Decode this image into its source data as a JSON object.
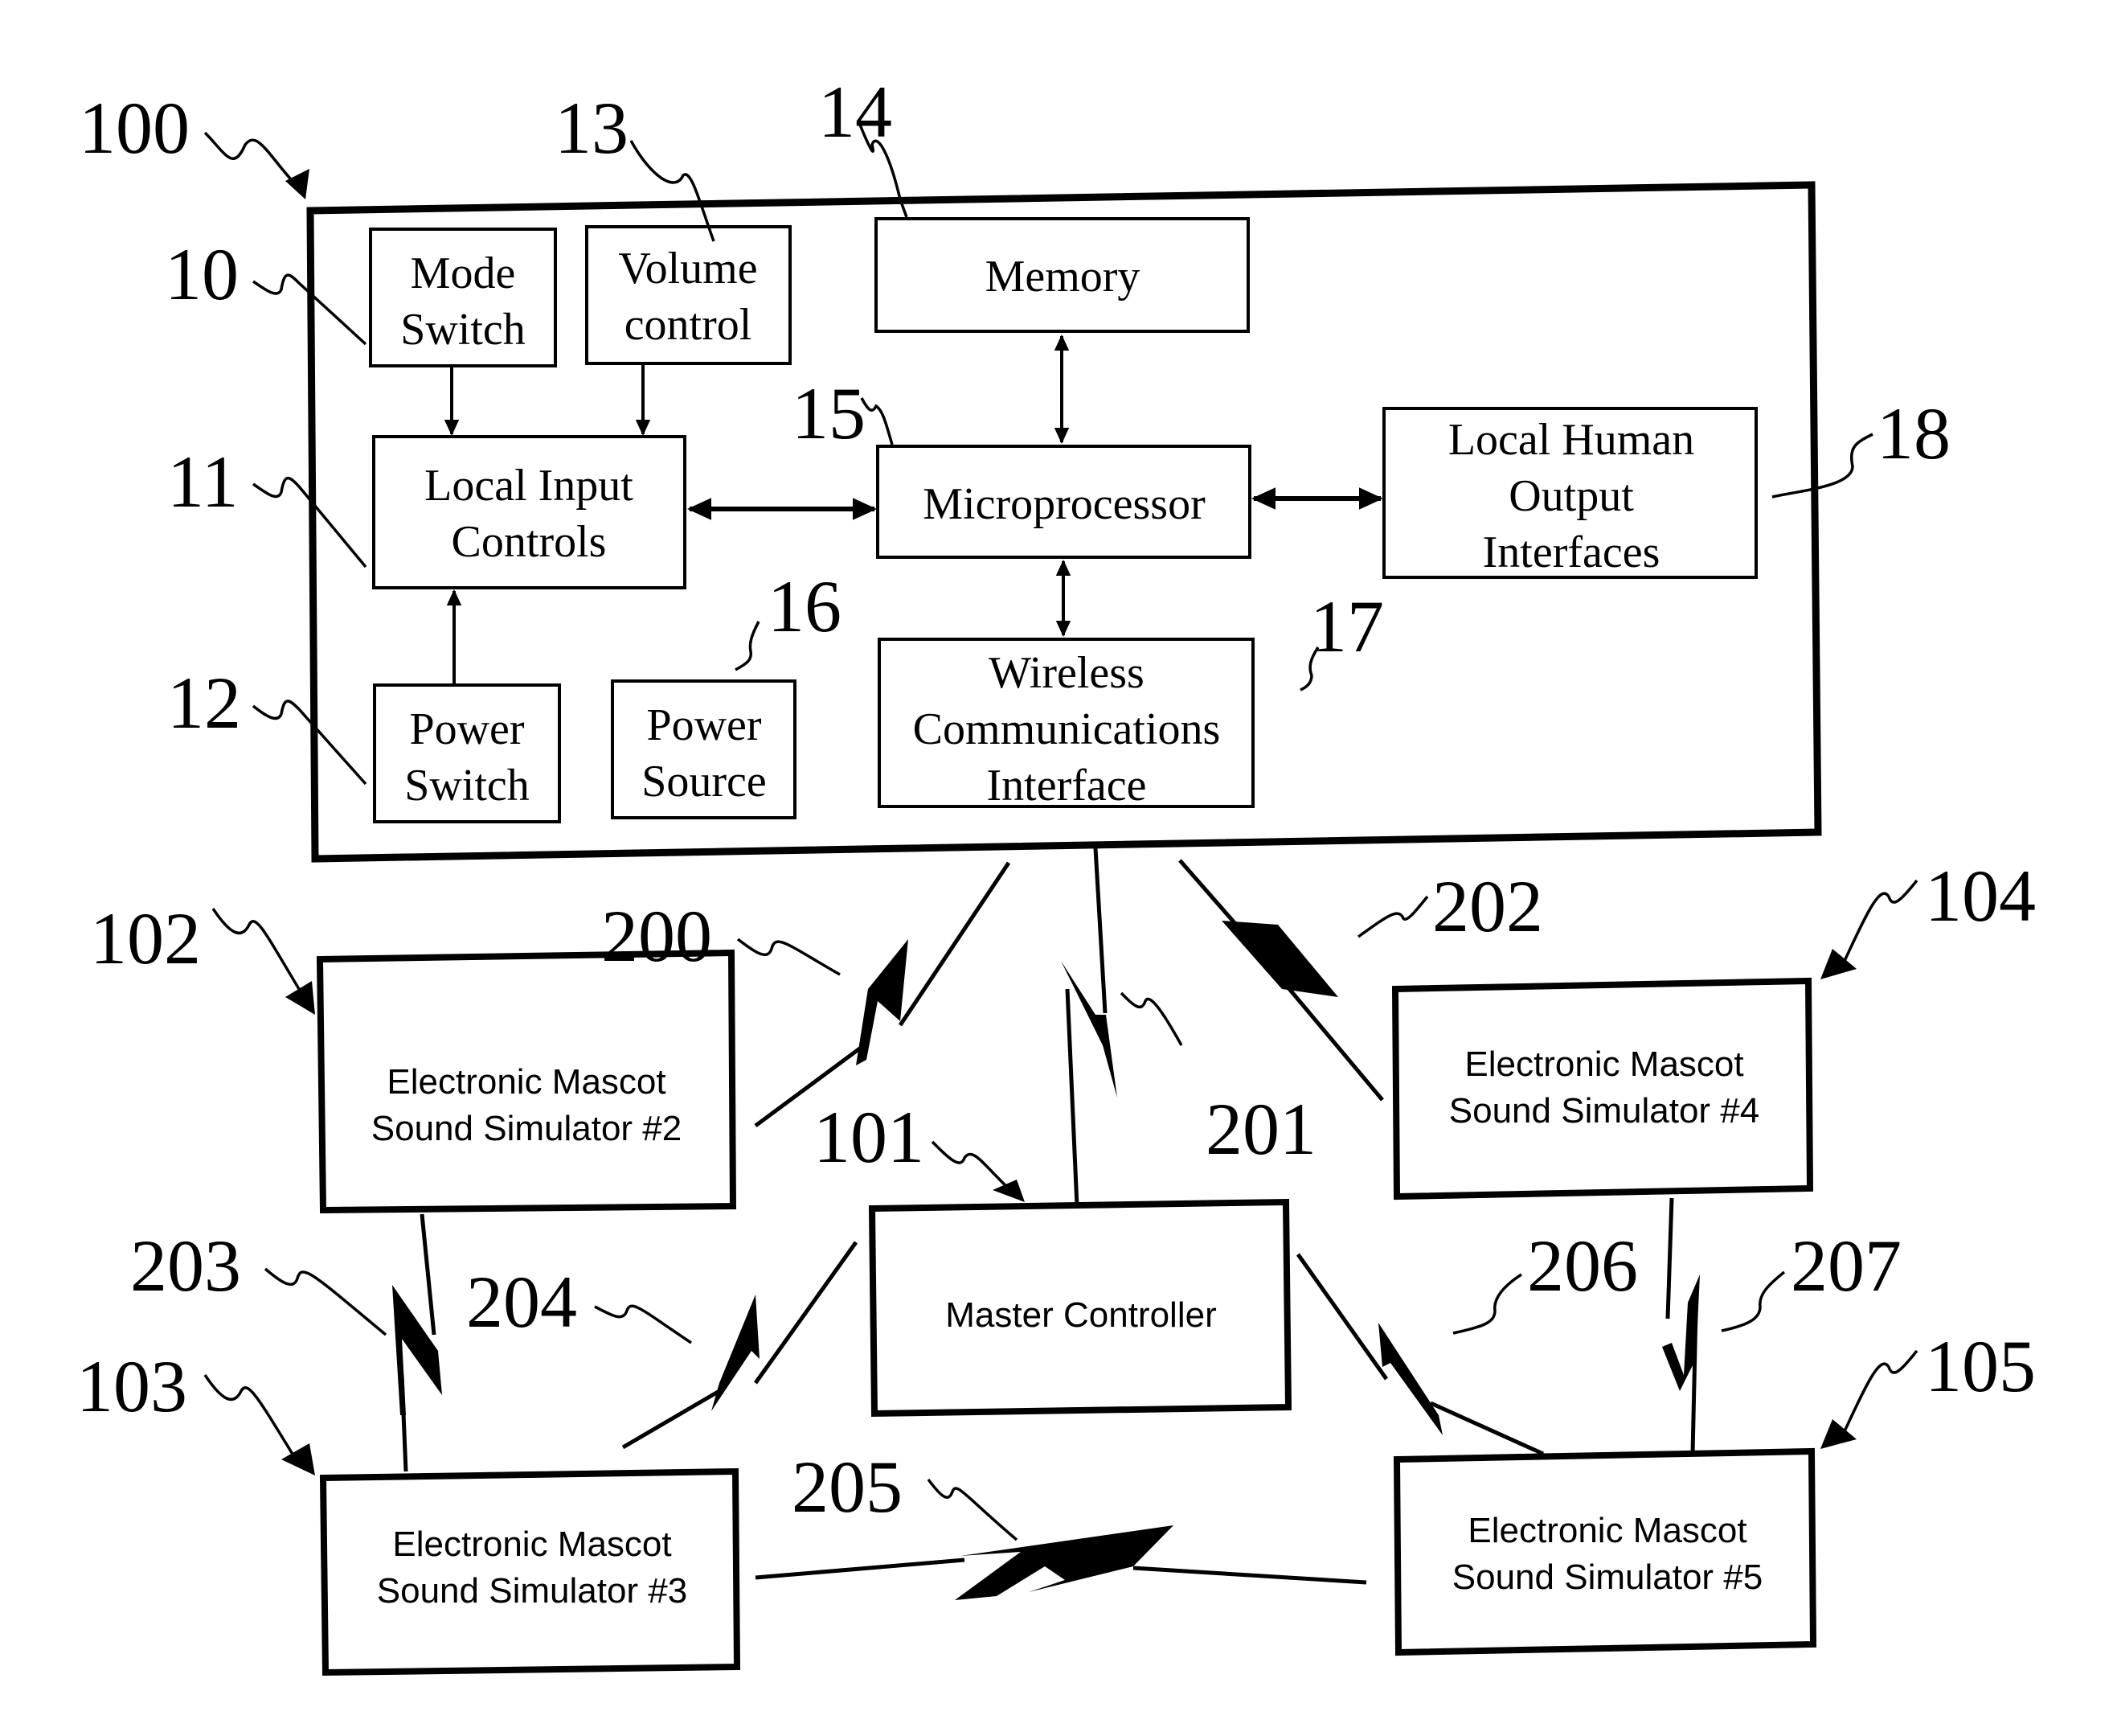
{
  "figure": {
    "device_ref": "100",
    "components": [
      {
        "id": "mode_switch",
        "ref": "10",
        "lines": [
          "Mode",
          "Switch"
        ]
      },
      {
        "id": "local_input_controls",
        "ref": "11",
        "lines": [
          "Local Input",
          "Controls"
        ]
      },
      {
        "id": "power_switch",
        "ref": "12",
        "lines": [
          "Power",
          "Switch"
        ]
      },
      {
        "id": "volume_control",
        "ref": "13",
        "lines": [
          "Volume",
          "control"
        ]
      },
      {
        "id": "memory",
        "ref": "14",
        "lines": [
          "Memory"
        ]
      },
      {
        "id": "microprocessor",
        "ref": "15",
        "lines": [
          "Microprocessor"
        ]
      },
      {
        "id": "power_source",
        "ref": "16",
        "lines": [
          "Power",
          "Source"
        ]
      },
      {
        "id": "wireless_interface",
        "ref": "17",
        "lines": [
          "Wireless",
          "Communications",
          "Interface"
        ]
      },
      {
        "id": "local_human_output",
        "ref": "18",
        "lines": [
          "Local Human",
          "Output",
          "Interfaces"
        ]
      }
    ],
    "network_nodes": [
      {
        "id": "master_controller",
        "ref": "101",
        "lines": [
          "Master Controller"
        ]
      },
      {
        "id": "simulator_2",
        "ref": "102",
        "lines": [
          "Electronic Mascot",
          "Sound Simulator #2"
        ]
      },
      {
        "id": "simulator_3",
        "ref": "103",
        "lines": [
          "Electronic Mascot",
          "Sound Simulator #3"
        ]
      },
      {
        "id": "simulator_4",
        "ref": "104",
        "lines": [
          "Electronic Mascot",
          "Sound Simulator #4"
        ]
      },
      {
        "id": "simulator_5",
        "ref": "105",
        "lines": [
          "Electronic Mascot",
          "Sound Simulator #5"
        ]
      }
    ],
    "wireless_links": [
      {
        "ref": "200",
        "from": "device_100",
        "to": "simulator_2"
      },
      {
        "ref": "201",
        "from": "device_100",
        "to": "master_controller"
      },
      {
        "ref": "202",
        "from": "device_100",
        "to": "simulator_4"
      },
      {
        "ref": "203",
        "from": "simulator_2",
        "to": "simulator_3"
      },
      {
        "ref": "204",
        "from": "master_controller",
        "to": "simulator_3"
      },
      {
        "ref": "205",
        "from": "simulator_3",
        "to": "simulator_5"
      },
      {
        "ref": "206",
        "from": "master_controller",
        "to": "simulator_5"
      },
      {
        "ref": "207",
        "from": "simulator_4",
        "to": "simulator_5"
      }
    ],
    "connections": [
      {
        "from": "mode_switch",
        "to": "local_input_controls",
        "direction": "one-way"
      },
      {
        "from": "volume_control",
        "to": "local_input_controls",
        "direction": "one-way"
      },
      {
        "from": "power_switch",
        "to": "local_input_controls",
        "direction": "one-way"
      },
      {
        "from": "local_input_controls",
        "to": "microprocessor",
        "direction": "two-way"
      },
      {
        "from": "memory",
        "to": "microprocessor",
        "direction": "two-way"
      },
      {
        "from": "microprocessor",
        "to": "local_human_output",
        "direction": "two-way"
      },
      {
        "from": "microprocessor",
        "to": "wireless_interface",
        "direction": "two-way"
      }
    ]
  }
}
